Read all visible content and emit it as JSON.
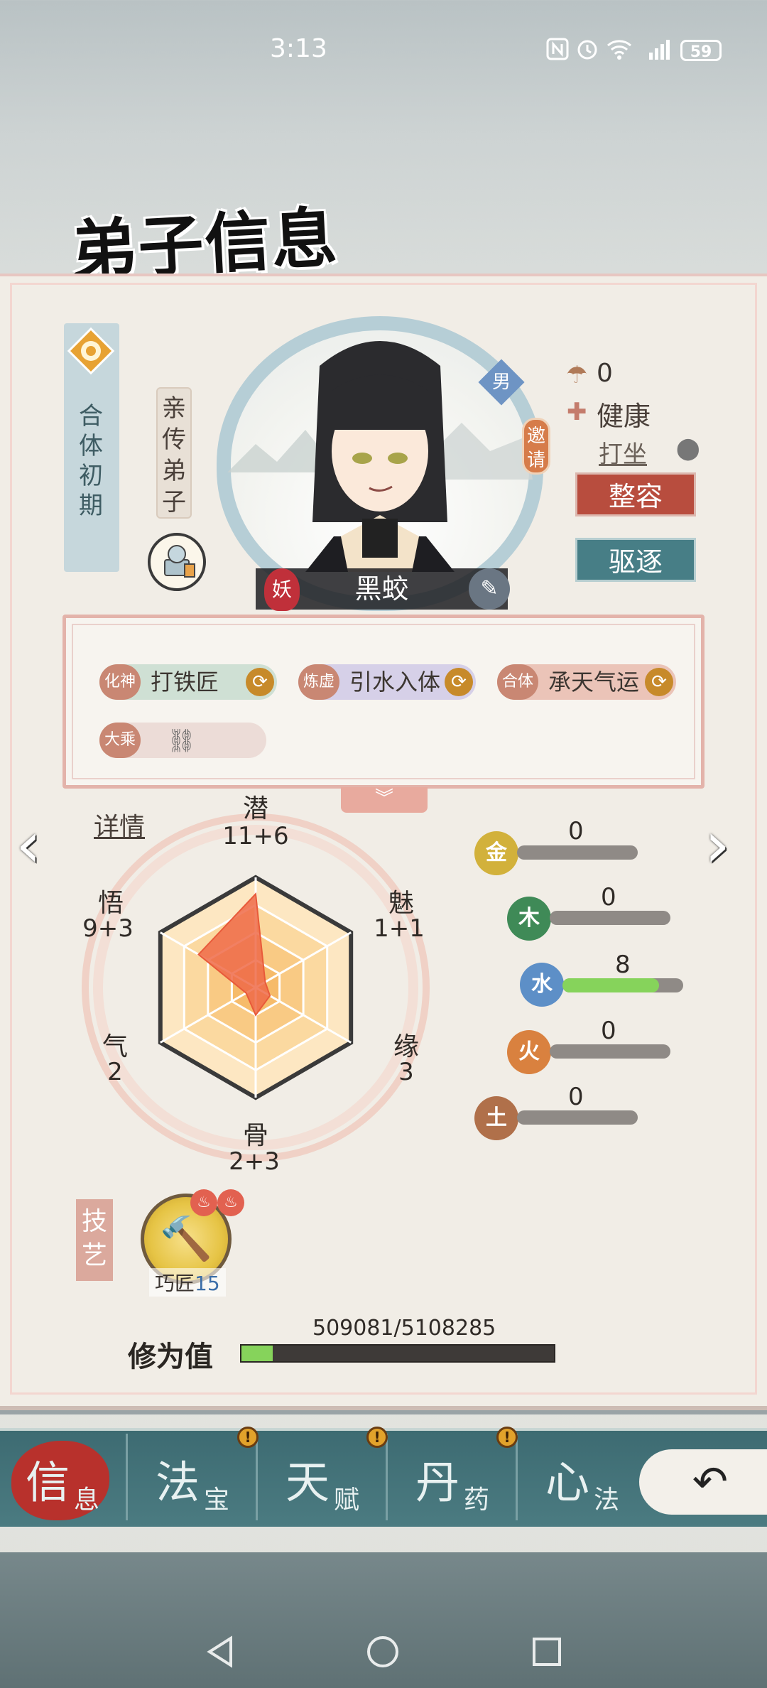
{
  "status_bar": {
    "time": "3:13",
    "battery": "59"
  },
  "title": "弟子信息",
  "realm": "合体初期",
  "role": "亲传弟子",
  "disciple": {
    "name": "黑蛟",
    "gender": "男",
    "race": "妖",
    "invite_label": "邀请",
    "luck": "0",
    "health": "健康",
    "activity": "打坐"
  },
  "buttons": {
    "reshape": "整容",
    "expel": "驱逐"
  },
  "traits": [
    {
      "tier": "化神",
      "name": "打铁匠"
    },
    {
      "tier": "炼虚",
      "name": "引水入体"
    },
    {
      "tier": "合体",
      "name": "承天气运"
    },
    {
      "tier": "大乘",
      "name": ""
    }
  ],
  "details_link": "详情",
  "stats": [
    {
      "name": "潜",
      "value": "11+6"
    },
    {
      "name": "魅",
      "value": "1+1"
    },
    {
      "name": "缘",
      "value": "3"
    },
    {
      "name": "骨",
      "value": "2+3"
    },
    {
      "name": "气",
      "value": "2"
    },
    {
      "name": "悟",
      "value": "9+3"
    }
  ],
  "radar_values": [
    17,
    2,
    3,
    5,
    2,
    12
  ],
  "radar_max": 20,
  "elements": [
    {
      "name": "金",
      "value": 0,
      "color": "#d2b13b"
    },
    {
      "name": "木",
      "value": 0,
      "color": "#3f8a57"
    },
    {
      "name": "水",
      "value": 8,
      "color": "#5d8fc7"
    },
    {
      "name": "火",
      "value": 0,
      "color": "#d9813f"
    },
    {
      "name": "土",
      "value": 0,
      "color": "#b0704a"
    }
  ],
  "element_max": 10,
  "skills": {
    "label": "技艺",
    "name": "巧匠",
    "level": "15"
  },
  "cultivation": {
    "label": "修为值",
    "current": 509081,
    "max": 5108285,
    "text": "509081/5108285"
  },
  "tabs": [
    {
      "big": "信",
      "small": "息",
      "alert": false
    },
    {
      "big": "法",
      "small": "宝",
      "alert": true
    },
    {
      "big": "天",
      "small": "赋",
      "alert": true
    },
    {
      "big": "丹",
      "small": "药",
      "alert": true
    },
    {
      "big": "心",
      "small": "法",
      "alert": false
    }
  ],
  "colors": {
    "accent_red": "#b84d3e",
    "accent_teal": "#477e86",
    "tab_bar": "#3d6b72"
  }
}
